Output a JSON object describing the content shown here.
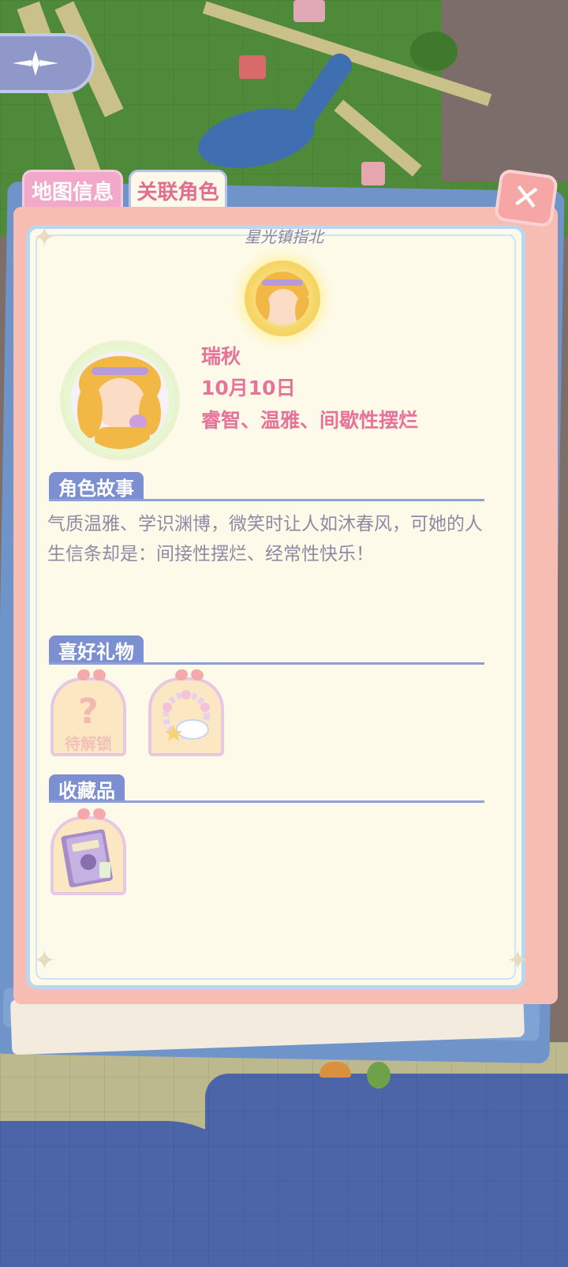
{
  "tabs": {
    "map_info": "地图信息",
    "related_character": "关联角色"
  },
  "close_icon": "close-icon",
  "brand_text": "星光镇指北",
  "character": {
    "name": "瑞秋",
    "birthday": "10月10日",
    "traits": "睿智、温雅、间歇性摆烂"
  },
  "sections": {
    "story_title": "角色故事",
    "story_text": "气质温雅、学识渊博，微笑时让人如沐春风，可她的人生信条却是：间接性摆烂、经常性快乐！",
    "gifts_title": "喜好礼物",
    "collections_title": "收藏品"
  },
  "gifts": [
    {
      "state": "locked",
      "label": "待解锁",
      "icon": "question-mark-icon"
    },
    {
      "state": "unlocked",
      "icon": "bracelet-icon"
    }
  ],
  "collections": [
    {
      "icon": "storybook-icon"
    }
  ],
  "colors": {
    "accent_pink": "#e6749a",
    "section_blue": "#7b8fd1",
    "paper": "#fdfaea",
    "card_border": "#f8bdb2"
  }
}
